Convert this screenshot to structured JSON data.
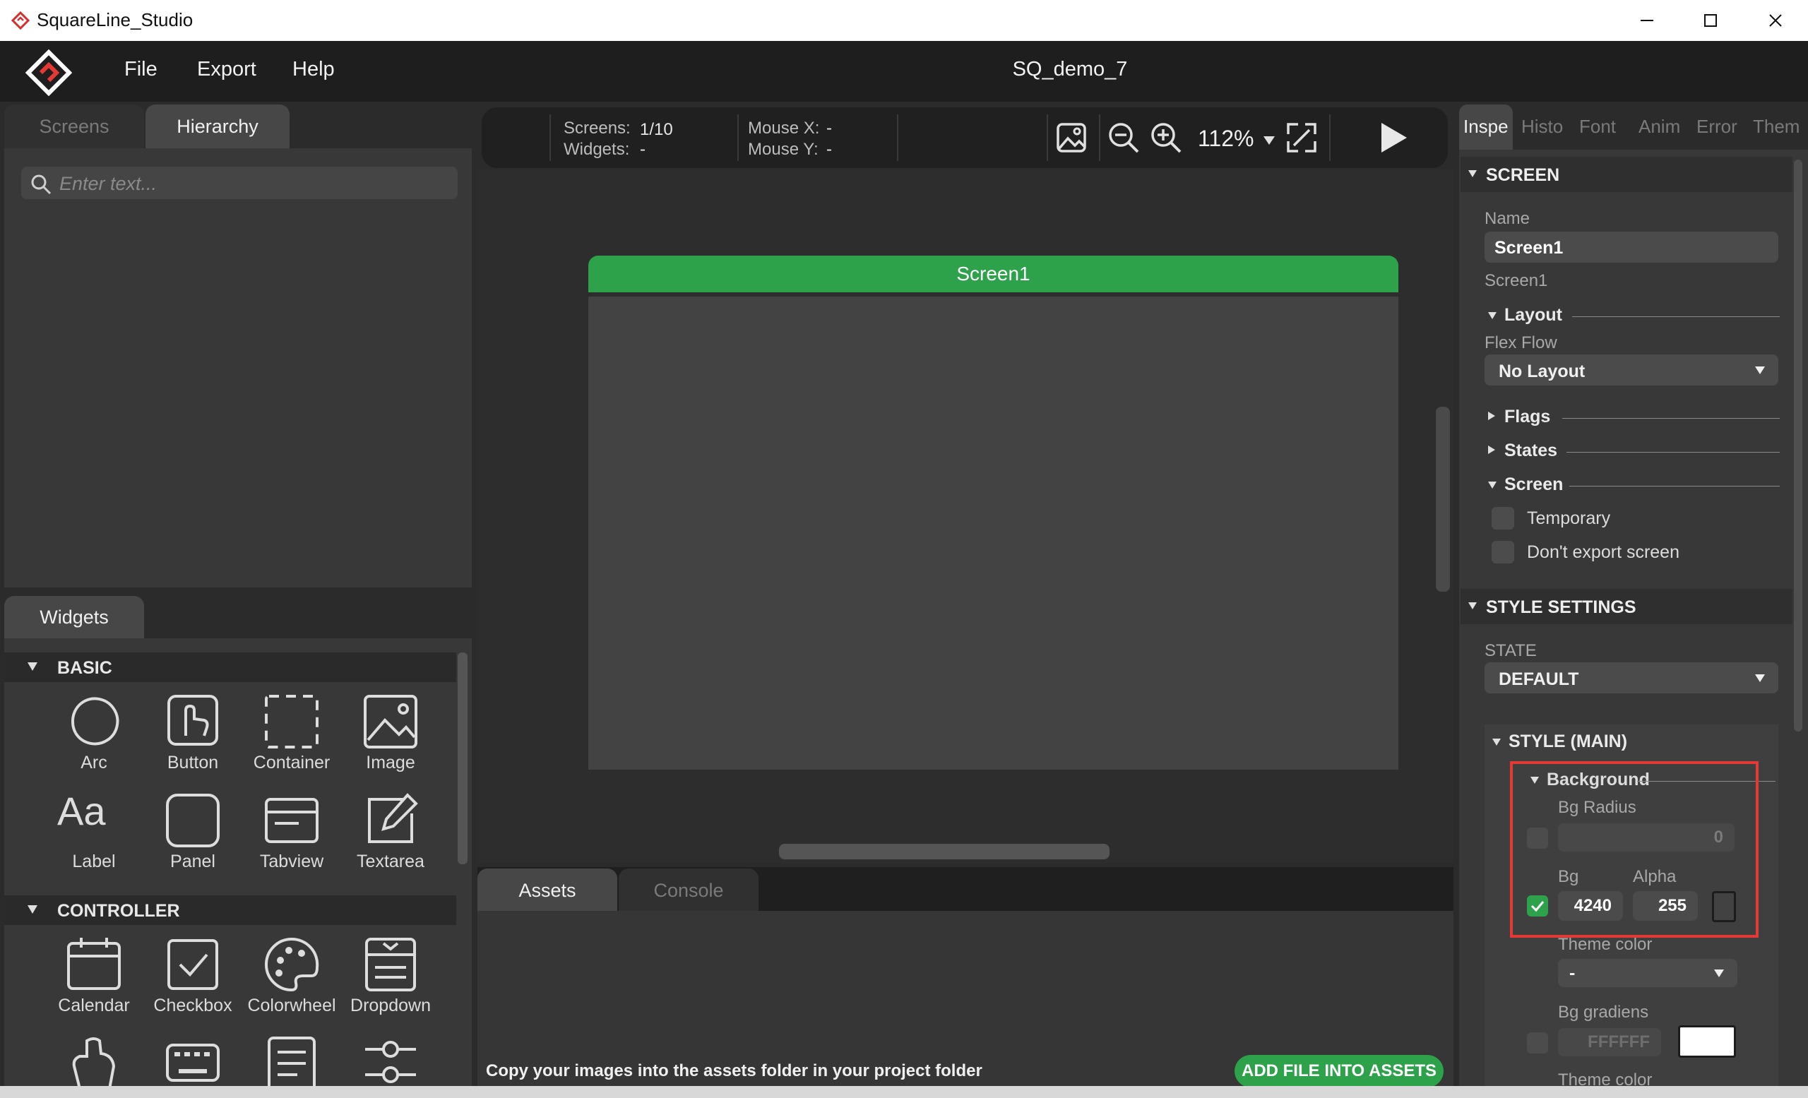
{
  "window": {
    "title": "SquareLine_Studio"
  },
  "menu": {
    "items": [
      "File",
      "Export",
      "Help"
    ],
    "project_title": "SQ_demo_7"
  },
  "left_panel": {
    "tabs": [
      "Screens",
      "Hierarchy"
    ],
    "search_placeholder": "Enter text..."
  },
  "widgets_panel": {
    "tab": "Widgets",
    "sections": [
      {
        "title": "BASIC",
        "items": [
          "Arc",
          "Button",
          "Container",
          "Image",
          "Label",
          "Panel",
          "Tabview",
          "Textarea"
        ]
      },
      {
        "title": "CONTROLLER",
        "items": [
          "Calendar",
          "Checkbox",
          "Colorwheel",
          "Dropdown"
        ]
      }
    ]
  },
  "toolbar": {
    "screens_label": "Screens:",
    "screens_value": "1/10",
    "widgets_label": "Widgets:",
    "widgets_value": "-",
    "mouse_x_label": "Mouse X:",
    "mouse_x_value": "-",
    "mouse_y_label": "Mouse Y:",
    "mouse_y_value": "-",
    "zoom": "112%"
  },
  "canvas": {
    "screen_name": "Screen1",
    "header_color": "#2ea24a"
  },
  "bottom_panel": {
    "tabs": [
      "Assets",
      "Console"
    ],
    "hint": "Copy your images into the assets folder in your project folder",
    "add_button": "ADD FILE INTO ASSETS"
  },
  "inspector": {
    "tabs": [
      "Inspe",
      "Histo",
      "Font",
      "Anim",
      "Error",
      "Them"
    ],
    "screen_section": "SCREEN",
    "name_label": "Name",
    "name_value": "Screen1",
    "type_label": "Screen1",
    "layout_title": "Layout",
    "flex_flow_label": "Flex Flow",
    "flex_flow_value": "No Layout",
    "flags_title": "Flags",
    "states_title": "States",
    "screen_title": "Screen",
    "temporary_label": "Temporary",
    "dont_export_label": "Don't export screen",
    "style_settings": "STYLE SETTINGS",
    "state_label": "STATE",
    "state_value": "DEFAULT",
    "style_main": "STYLE (MAIN)",
    "background_title": "Background",
    "bg_radius_label": "Bg Radius",
    "bg_radius_value": "0",
    "bg_label": "Bg",
    "alpha_label": "Alpha",
    "bg_value": "4240",
    "alpha_value": "255",
    "theme_color_label": "Theme color",
    "theme_color_value": "-",
    "bg_gradiens_label": "Bg gradiens",
    "bg_gradiens_value": "FFFFFF",
    "theme_color_label_2": "Theme color"
  },
  "colors": {
    "accent_green": "#2ea24a",
    "highlight_red": "#e53935"
  }
}
